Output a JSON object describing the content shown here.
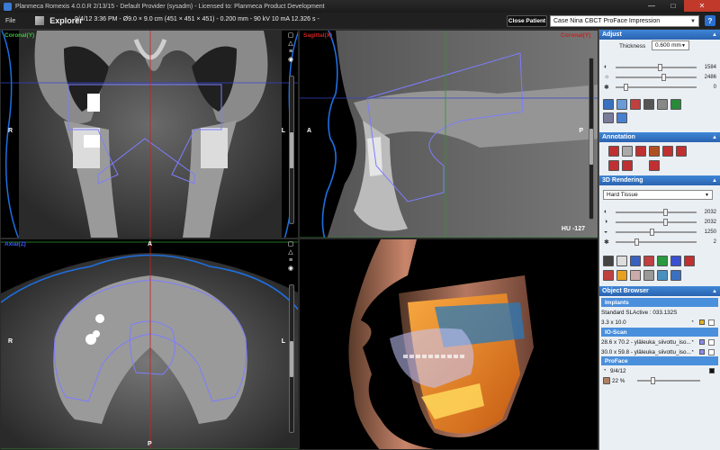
{
  "window": {
    "title": "Planmeca Romexis 4.0.0.R  2/13/15 - Default Provider (sysadm) - Licensed to: Planmeca Product Development",
    "min": "—",
    "max": "□",
    "close": "✕"
  },
  "toolbar": {
    "file": "File",
    "explorer": "Explorer",
    "info": "9/4/12 3:36 PM - Ø9.0 × 9.0 cm (451 × 451 × 451) - 0.200 mm - 90 kV 10 mA 12.326 s -",
    "close_patient": "Close Patient",
    "case": "Case Nina CBCT ProFace Impression",
    "help": "?"
  },
  "viewports": {
    "coronal": {
      "label": "Coronal(Y)",
      "left": "R",
      "right": "L"
    },
    "sagittal": {
      "label": "Sagittal(X)",
      "label_right": "Coronal(Y)",
      "left": "A",
      "right": "P",
      "hu": "HU -127"
    },
    "axial": {
      "label": "Axial(Z)",
      "top": "A",
      "bottom": "P",
      "left": "R",
      "right": "L"
    }
  },
  "panel": {
    "adjust": {
      "title": "Adjust",
      "thickness_label": "Thickness",
      "thickness_value": "0.600 mm",
      "sliders": [
        {
          "value": "1584",
          "level": 0.55
        },
        {
          "value": "2486",
          "level": 0.6
        },
        {
          "value": "0",
          "level": 0.1
        }
      ]
    },
    "annotation": {
      "title": "Annotation"
    },
    "rendering": {
      "title": "3D Rendering",
      "preset": "Hard Tissue",
      "sliders": [
        {
          "value": "2032",
          "level": 0.62
        },
        {
          "value": "2032",
          "level": 0.62
        },
        {
          "value": "1250",
          "level": 0.45
        },
        {
          "value": "2",
          "level": 0.25
        }
      ]
    },
    "browser": {
      "title": "Object Browser",
      "implants_hdr": "Implants",
      "implant_name": "Standard SLActive : 033.132S",
      "implant_size": "3.3 x 10.0",
      "io_hdr": "IO-Scan",
      "io_items": [
        "28.6 x 70.2 - yläleuka_siivottu_iso...",
        "30.0 x 59.8 - yläleuka_siivottu_iso..."
      ],
      "proface_hdr": "ProFace",
      "proface_date": "9/4/12",
      "opacity": "22 %"
    }
  },
  "colors": {
    "accent": "#2a63b0",
    "crosshair_red": "#d02020",
    "crosshair_green": "#2a9a2a",
    "crosshair_blue": "#3344cc",
    "skin_line": "#1e6fe0"
  }
}
